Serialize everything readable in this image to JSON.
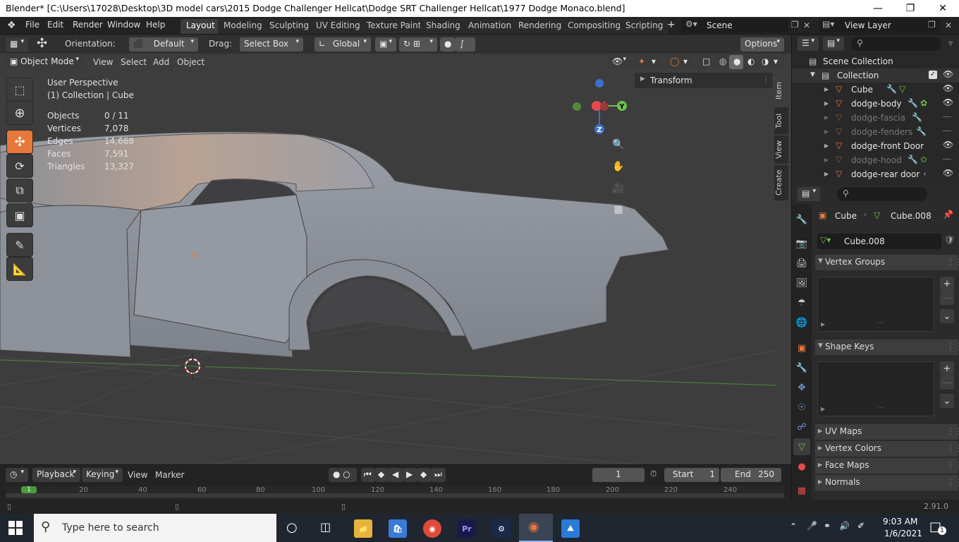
{
  "window": {
    "title": "Blender* [C:\\Users\\17028\\Desktop\\3D model cars\\2015 Dodge Challenger Hellcat\\Dodge SRT Challenger Hellcat\\1977 Dodge Monaco.blend]"
  },
  "menu": [
    "File",
    "Edit",
    "Render",
    "Window",
    "Help"
  ],
  "workspaces": [
    "Layout",
    "Modeling",
    "Sculpting",
    "UV Editing",
    "Texture Paint",
    "Shading",
    "Animation",
    "Rendering",
    "Compositing",
    "Scripting"
  ],
  "workspace_add": "+",
  "scene": {
    "label": "Scene"
  },
  "view_layer": {
    "label": "View Layer"
  },
  "toolbar": {
    "orientation_label": "Orientation:",
    "orientation_value": "Default",
    "drag_label": "Drag:",
    "drag_value": "Select Box",
    "transform_value": "Global",
    "options_label": "Options"
  },
  "viewport_header": {
    "mode": "Object Mode",
    "items": [
      "View",
      "Select",
      "Add",
      "Object"
    ]
  },
  "overlay": {
    "perspective": "User Perspective",
    "collection": "(1) Collection | Cube",
    "stats": [
      {
        "label": "Objects",
        "value": "0 / 11"
      },
      {
        "label": "Vertices",
        "value": "7,078"
      },
      {
        "label": "Edges",
        "value": "14,668"
      },
      {
        "label": "Faces",
        "value": "7,591"
      },
      {
        "label": "Triangles",
        "value": "13,327"
      }
    ]
  },
  "gizmo": {
    "y": "Y",
    "z": "Z"
  },
  "n_panel": {
    "transform": "Transform"
  },
  "side_tabs": [
    "Item",
    "Tool",
    "View",
    "Create"
  ],
  "outliner": {
    "scene_collection": "Scene Collection",
    "collection": "Collection",
    "items": [
      {
        "name": "Cube",
        "dim": false
      },
      {
        "name": "dodge-body",
        "dim": false
      },
      {
        "name": "dodge-fascia",
        "dim": true
      },
      {
        "name": "dodge-fenders",
        "dim": true
      },
      {
        "name": "dodge-front Door",
        "dim": false
      },
      {
        "name": "dodge-hood",
        "dim": true
      },
      {
        "name": "dodge-rear door",
        "dim": false
      }
    ]
  },
  "properties": {
    "breadcrumb_object": "Cube",
    "breadcrumb_mesh": "Cube.008",
    "mesh_name": "Cube.008",
    "panels": {
      "vertex_groups": "Vertex Groups",
      "shape_keys": "Shape Keys",
      "uv_maps": "UV Maps",
      "vertex_colors": "Vertex Colors",
      "face_maps": "Face Maps",
      "normals": "Normals"
    }
  },
  "timeline": {
    "menus": [
      "Playback",
      "Keying",
      "View",
      "Marker"
    ],
    "current_frame": "1",
    "start_label": "Start",
    "start_value": "1",
    "end_label": "End",
    "end_value": "250",
    "ruler": [
      "1",
      "20",
      "40",
      "60",
      "80",
      "100",
      "120",
      "140",
      "160",
      "180",
      "200",
      "220",
      "240"
    ]
  },
  "statusbar": {
    "version": "2.91.0"
  },
  "taskbar": {
    "search_placeholder": "Type here to search",
    "time": "9:03 AM",
    "date": "1/6/2021",
    "notifications": "1"
  },
  "colors": {
    "accent": "#e8773a",
    "active_tab": "#3d3d3d",
    "axis_x": "#e84a4a",
    "axis_y": "#6bc34a",
    "axis_z": "#3d6fcc"
  }
}
